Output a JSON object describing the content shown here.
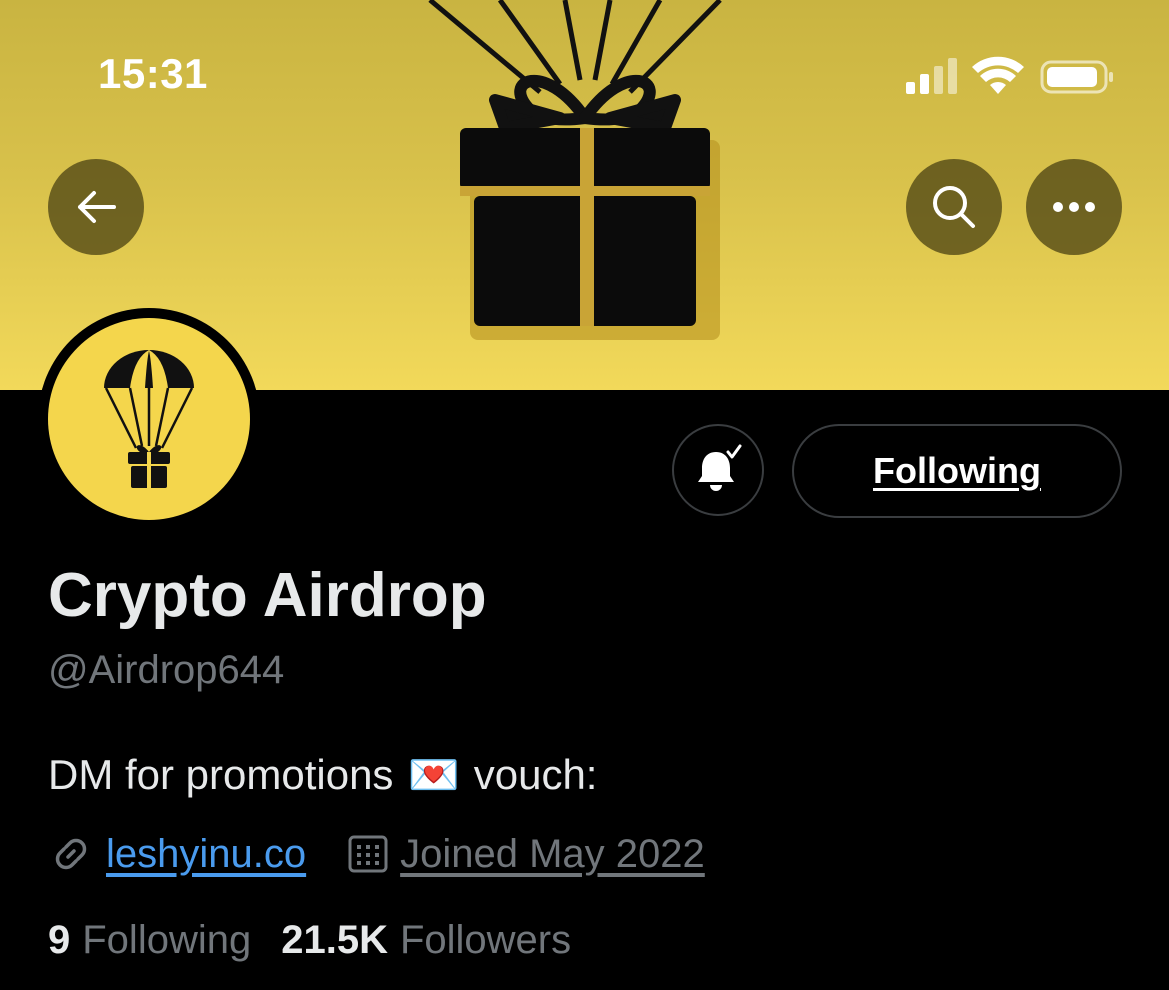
{
  "status_bar": {
    "time": "15:31"
  },
  "header": {
    "back_icon": "arrow-left-icon",
    "search_icon": "search-icon",
    "more_icon": "more-horizontal-icon",
    "banner_color": "#d8c14b"
  },
  "profile": {
    "display_name": "Crypto Airdrop",
    "handle": "@Airdrop644",
    "bio_text": "DM for promotions",
    "bio_emoji": "💌",
    "bio_suffix": "vouch:",
    "website": "leshyinu.co",
    "joined": "Joined May 2022",
    "following_count": "9",
    "following_label": "Following",
    "followers_count": "21.5K",
    "followers_label": "Followers",
    "avatar_color": "#f4d64c"
  },
  "actions": {
    "notify_icon": "bell-check-icon",
    "following_button": "Following"
  },
  "colors": {
    "link": "#4a9bee",
    "muted": "#71767b",
    "text": "#e7e9ea"
  }
}
